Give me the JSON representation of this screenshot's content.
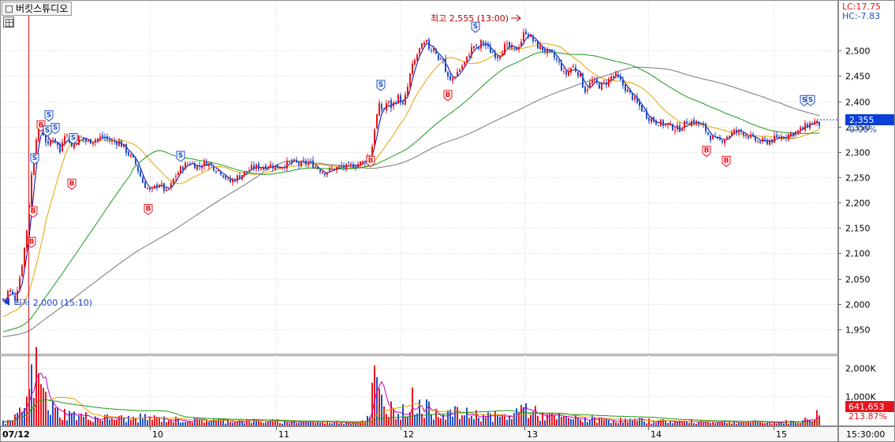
{
  "window": {
    "title": "버킷스튜디오"
  },
  "indicators": {
    "lc": "LC:17.75",
    "hc": "HC:-7.83"
  },
  "annotations": {
    "high": "최고 2,555 (13:00)",
    "low": "최저 2,000 (15:10)"
  },
  "current": {
    "price_label": "2,355",
    "change_label": "0.00%",
    "price": 2355
  },
  "volume_panel": {
    "current_label": "641,653",
    "ratio_label": "213.87%"
  },
  "time_label": "15:30:00",
  "colors": {
    "up": "#e8141c",
    "down": "#1f4fc8",
    "ma5": "#0000aa",
    "ma20": "#e8a000",
    "ma60": "#1a9a1a",
    "ma120": "#777777",
    "highlight": "#0a3fd8"
  },
  "chart_data": {
    "type": "candlestick",
    "price_axis": {
      "ticks": [
        1950,
        2000,
        2050,
        2100,
        2150,
        2200,
        2250,
        2300,
        2350,
        2400,
        2450,
        2500
      ],
      "tick_labels": [
        "1,950",
        "2,000",
        "2,050",
        "2,100",
        "2,150",
        "2,200",
        "2,250",
        "2,300",
        "2,350",
        "2,400",
        "2,450",
        "2,500"
      ],
      "range": [
        1900,
        2600
      ]
    },
    "volume_axis": {
      "ticks": [
        1000000,
        2000000
      ],
      "tick_labels": [
        "1,000K",
        "2,000K"
      ],
      "range": [
        0,
        2300000
      ]
    },
    "date_labels": [
      "07/12",
      "10",
      "11",
      "12",
      "13",
      "14",
      "15"
    ],
    "price_path": [
      [
        0,
        2010
      ],
      [
        5,
        2005
      ],
      [
        10,
        2030
      ],
      [
        18,
        2010
      ],
      [
        25,
        2060
      ],
      [
        30,
        2110
      ],
      [
        34,
        2160
      ],
      [
        38,
        2240
      ],
      [
        42,
        2300
      ],
      [
        46,
        2340
      ],
      [
        50,
        2360
      ],
      [
        55,
        2330
      ],
      [
        60,
        2310
      ],
      [
        65,
        2330
      ],
      [
        70,
        2320
      ],
      [
        75,
        2300
      ],
      [
        80,
        2340
      ],
      [
        85,
        2330
      ],
      [
        90,
        2310
      ],
      [
        95,
        2320
      ],
      [
        100,
        2330
      ],
      [
        110,
        2320
      ],
      [
        120,
        2325
      ],
      [
        130,
        2330
      ],
      [
        140,
        2320
      ],
      [
        150,
        2320
      ],
      [
        160,
        2300
      ],
      [
        170,
        2280
      ],
      [
        175,
        2260
      ],
      [
        180,
        2240
      ],
      [
        185,
        2230
      ],
      [
        190,
        2220
      ],
      [
        195,
        2230
      ],
      [
        200,
        2240
      ],
      [
        205,
        2230
      ],
      [
        210,
        2220
      ],
      [
        215,
        2230
      ],
      [
        220,
        2250
      ],
      [
        225,
        2260
      ],
      [
        230,
        2270
      ],
      [
        240,
        2280
      ],
      [
        250,
        2270
      ],
      [
        260,
        2280
      ],
      [
        270,
        2270
      ],
      [
        280,
        2260
      ],
      [
        290,
        2240
      ],
      [
        300,
        2250
      ],
      [
        310,
        2260
      ],
      [
        320,
        2270
      ],
      [
        330,
        2270
      ],
      [
        340,
        2275
      ],
      [
        350,
        2270
      ],
      [
        360,
        2275
      ],
      [
        370,
        2280
      ],
      [
        380,
        2275
      ],
      [
        390,
        2280
      ],
      [
        400,
        2270
      ],
      [
        410,
        2260
      ],
      [
        420,
        2265
      ],
      [
        430,
        2270
      ],
      [
        440,
        2270
      ],
      [
        450,
        2275
      ],
      [
        460,
        2280
      ],
      [
        470,
        2300
      ],
      [
        475,
        2360
      ],
      [
        480,
        2390
      ],
      [
        485,
        2380
      ],
      [
        490,
        2400
      ],
      [
        495,
        2390
      ],
      [
        500,
        2400
      ],
      [
        505,
        2410
      ],
      [
        510,
        2390
      ],
      [
        515,
        2420
      ],
      [
        520,
        2460
      ],
      [
        525,
        2480
      ],
      [
        530,
        2500
      ],
      [
        535,
        2510
      ],
      [
        540,
        2515
      ],
      [
        545,
        2500
      ],
      [
        550,
        2510
      ],
      [
        555,
        2480
      ],
      [
        560,
        2490
      ],
      [
        565,
        2450
      ],
      [
        570,
        2440
      ],
      [
        575,
        2450
      ],
      [
        580,
        2460
      ],
      [
        585,
        2470
      ],
      [
        590,
        2480
      ],
      [
        595,
        2500
      ],
      [
        600,
        2510
      ],
      [
        605,
        2500
      ],
      [
        610,
        2520
      ],
      [
        615,
        2510
      ],
      [
        620,
        2500
      ],
      [
        630,
        2490
      ],
      [
        640,
        2510
      ],
      [
        650,
        2500
      ],
      [
        655,
        2505
      ],
      [
        660,
        2520
      ],
      [
        665,
        2540
      ],
      [
        670,
        2530
      ],
      [
        675,
        2520
      ],
      [
        680,
        2510
      ],
      [
        690,
        2500
      ],
      [
        700,
        2490
      ],
      [
        710,
        2470
      ],
      [
        715,
        2450
      ],
      [
        720,
        2460
      ],
      [
        725,
        2470
      ],
      [
        730,
        2460
      ],
      [
        735,
        2450
      ],
      [
        740,
        2420
      ],
      [
        745,
        2430
      ],
      [
        750,
        2440
      ],
      [
        760,
        2430
      ],
      [
        770,
        2440
      ],
      [
        775,
        2450
      ],
      [
        780,
        2450
      ],
      [
        790,
        2430
      ],
      [
        800,
        2410
      ],
      [
        810,
        2390
      ],
      [
        820,
        2370
      ],
      [
        830,
        2360
      ],
      [
        840,
        2355
      ],
      [
        850,
        2350
      ],
      [
        860,
        2345
      ],
      [
        870,
        2360
      ],
      [
        880,
        2360
      ],
      [
        890,
        2350
      ],
      [
        900,
        2330
      ],
      [
        910,
        2320
      ],
      [
        920,
        2330
      ],
      [
        930,
        2340
      ],
      [
        940,
        2340
      ],
      [
        950,
        2330
      ],
      [
        960,
        2320
      ],
      [
        970,
        2320
      ],
      [
        980,
        2325
      ],
      [
        990,
        2330
      ],
      [
        1000,
        2335
      ],
      [
        1010,
        2340
      ],
      [
        1020,
        2350
      ],
      [
        1030,
        2360
      ],
      [
        1036,
        2355
      ]
    ],
    "volume_path": [
      [
        0,
        120000
      ],
      [
        10,
        150000
      ],
      [
        20,
        400000
      ],
      [
        30,
        900000
      ],
      [
        35,
        1500000
      ],
      [
        40,
        2100000
      ],
      [
        45,
        1900000
      ],
      [
        50,
        1300000
      ],
      [
        55,
        900000
      ],
      [
        60,
        700000
      ],
      [
        70,
        500000
      ],
      [
        80,
        450000
      ],
      [
        90,
        400000
      ],
      [
        100,
        350000
      ],
      [
        120,
        300000
      ],
      [
        140,
        280000
      ],
      [
        160,
        260000
      ],
      [
        180,
        300000
      ],
      [
        200,
        250000
      ],
      [
        220,
        220000
      ],
      [
        250,
        200000
      ],
      [
        300,
        180000
      ],
      [
        350,
        150000
      ],
      [
        400,
        130000
      ],
      [
        450,
        130000
      ],
      [
        465,
        300000
      ],
      [
        470,
        1800000
      ],
      [
        475,
        1300000
      ],
      [
        480,
        900000
      ],
      [
        490,
        700000
      ],
      [
        500,
        600000
      ],
      [
        510,
        500000
      ],
      [
        520,
        1000000
      ],
      [
        530,
        700000
      ],
      [
        540,
        600000
      ],
      [
        560,
        500000
      ],
      [
        580,
        450000
      ],
      [
        600,
        400000
      ],
      [
        620,
        350000
      ],
      [
        640,
        300000
      ],
      [
        660,
        700000
      ],
      [
        680,
        400000
      ],
      [
        700,
        300000
      ],
      [
        740,
        250000
      ],
      [
        780,
        200000
      ],
      [
        820,
        180000
      ],
      [
        860,
        150000
      ],
      [
        900,
        150000
      ],
      [
        940,
        130000
      ],
      [
        980,
        120000
      ],
      [
        1010,
        150000
      ],
      [
        1030,
        300000
      ],
      [
        1036,
        641653
      ]
    ],
    "buy_signal_markers": [
      [
        40,
        2140
      ],
      [
        42,
        2200
      ],
      [
        52,
        2370
      ],
      [
        91,
        2255
      ],
      [
        188,
        2205
      ],
      [
        470,
        2300
      ],
      [
        568,
        2430
      ],
      [
        896,
        2320
      ],
      [
        921,
        2300
      ]
    ],
    "sell_signal_markers": [
      [
        44,
        2265
      ],
      [
        62,
        2350
      ],
      [
        60,
        2320
      ],
      [
        70,
        2325
      ],
      [
        93,
        2305
      ],
      [
        229,
        2270
      ],
      [
        483,
        2410
      ],
      [
        603,
        2525
      ],
      [
        1020,
        2380
      ],
      [
        1028,
        2380
      ]
    ],
    "moving_averages": [
      "MA5",
      "MA20",
      "MA60",
      "MA120"
    ]
  }
}
